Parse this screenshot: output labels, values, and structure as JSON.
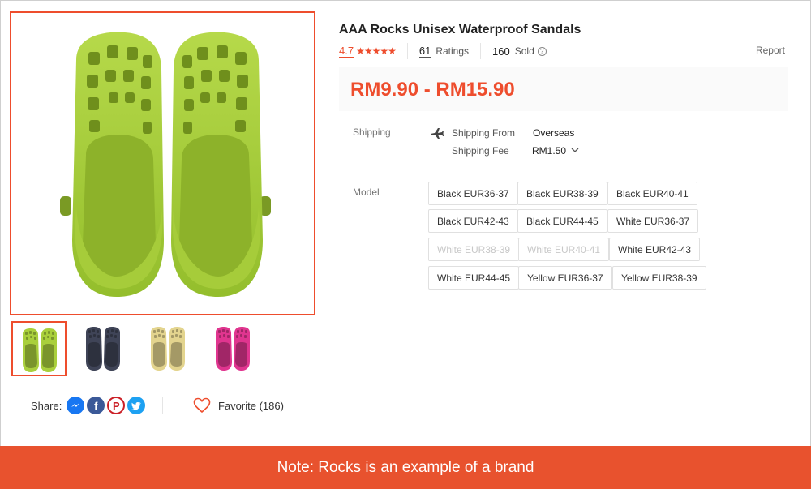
{
  "product": {
    "title": "AAA Rocks Unisex Waterproof Sandals",
    "rating": "4.7",
    "stars": "★★★★★",
    "ratings_count": "61",
    "ratings_label": "Ratings",
    "sold_count": "160",
    "sold_label": "Sold",
    "report_label": "Report",
    "price": "RM9.90 - RM15.90"
  },
  "shipping": {
    "label": "Shipping",
    "from_label": "Shipping From",
    "from_value": "Overseas",
    "fee_label": "Shipping Fee",
    "fee_value": "RM1.50"
  },
  "model": {
    "label": "Model",
    "options": [
      {
        "label": "Black EUR36-37",
        "disabled": false
      },
      {
        "label": "Black EUR38-39",
        "disabled": false
      },
      {
        "label": "Black EUR40-41",
        "disabled": false
      },
      {
        "label": "Black EUR42-43",
        "disabled": false
      },
      {
        "label": "Black EUR44-45",
        "disabled": false
      },
      {
        "label": "White EUR36-37",
        "disabled": false
      },
      {
        "label": "White EUR38-39",
        "disabled": true
      },
      {
        "label": "White EUR40-41",
        "disabled": true
      },
      {
        "label": "White EUR42-43",
        "disabled": false
      },
      {
        "label": "White EUR44-45",
        "disabled": false
      },
      {
        "label": "Yellow EUR36-37",
        "disabled": false
      },
      {
        "label": "Yellow EUR38-39",
        "disabled": false
      }
    ]
  },
  "gallery": {
    "thumbnails": [
      {
        "color": "#a9cf3c",
        "selected": true
      },
      {
        "color": "#3f4457",
        "selected": false
      },
      {
        "color": "#e3d48e",
        "selected": false
      },
      {
        "color": "#e0358f",
        "selected": false
      }
    ]
  },
  "social": {
    "share_label": "Share:",
    "favorite_label": "Favorite (186)"
  },
  "note": "Note: Rocks is an example of a brand",
  "colors": {
    "accent": "#ee4d2d",
    "note_bar": "#e8522e",
    "sandal_green": "#a9cf3c"
  }
}
